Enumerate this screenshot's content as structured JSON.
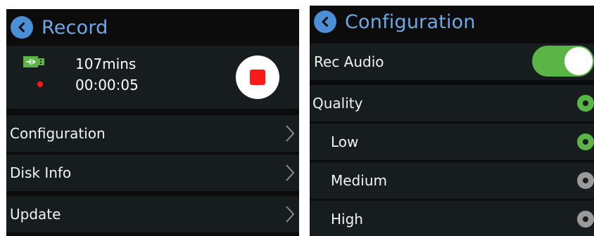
{
  "left_panel": {
    "title": "Record",
    "status": {
      "remaining": "107mins",
      "elapsed": "00:00:05"
    },
    "icons": {
      "back": "back-icon",
      "usb": "usb-drive-icon",
      "record_indicator": "recording-dot-icon",
      "stop": "stop-icon",
      "chevron": "chevron-right-icon"
    },
    "menu": [
      {
        "label": "Configuration"
      },
      {
        "label": "Disk Info"
      },
      {
        "label": "Update"
      }
    ]
  },
  "right_panel": {
    "title": "Configuration",
    "rec_audio": {
      "label": "Rec Audio",
      "enabled": true
    },
    "quality": {
      "label": "Quality",
      "options": [
        {
          "label": "Low",
          "selected": true
        },
        {
          "label": "Medium",
          "selected": false
        },
        {
          "label": "High",
          "selected": false
        }
      ]
    }
  },
  "colors": {
    "accent": "#6fa8e8",
    "back_button": "#4d8fd6",
    "active_green": "#5bb546",
    "record_red": "#ff1a1a",
    "inactive_gray": "#9a9a9a",
    "row_background": "#171d1f",
    "panel_background": "#0c0c0c"
  }
}
